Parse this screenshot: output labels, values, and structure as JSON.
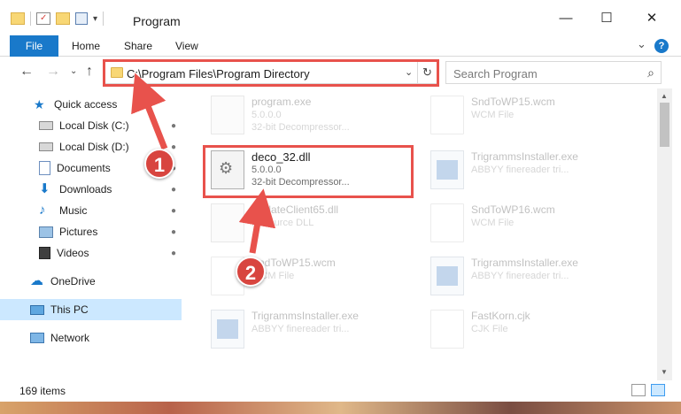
{
  "window": {
    "title": "Program",
    "min": "—",
    "max": "☐",
    "close": "✕"
  },
  "ribbon": {
    "file": "File",
    "home": "Home",
    "share": "Share",
    "view": "View",
    "expand": "⌄",
    "help": "?"
  },
  "nav": {
    "back": "←",
    "forward": "→",
    "recent": "⌄",
    "up": "↑",
    "address": "C:\\Program Files\\Program Directory",
    "address_dropdown": "⌄",
    "refresh": "↻",
    "search_placeholder": "Search Program",
    "search_icon": "⌕"
  },
  "sidebar": {
    "items": [
      {
        "label": "Quick access",
        "icon": "star-icon"
      },
      {
        "label": "Local Disk (C:)",
        "icon": "drive-icon"
      },
      {
        "label": "Local Disk (D:)",
        "icon": "drive-icon"
      },
      {
        "label": "Documents",
        "icon": "documents-icon"
      },
      {
        "label": "Downloads",
        "icon": "download-icon"
      },
      {
        "label": "Music",
        "icon": "music-icon"
      },
      {
        "label": "Pictures",
        "icon": "pictures-icon"
      },
      {
        "label": "Videos",
        "icon": "videos-icon"
      },
      {
        "label": "OneDrive",
        "icon": "cloud-icon"
      },
      {
        "label": "This PC",
        "icon": "computer-icon"
      },
      {
        "label": "Network",
        "icon": "network-icon"
      }
    ],
    "pin_glyph": "📌"
  },
  "files": [
    {
      "name": "program.exe",
      "line2": "5.0.0.0",
      "line3": "32-bit Decompressor...",
      "icon": "exe-icon"
    },
    {
      "name": "SndToWP15.wcm",
      "line2": "WCM File",
      "line3": "",
      "icon": "document-icon"
    },
    {
      "name": "deco_32.dll",
      "line2": "5.0.0.0",
      "line3": "32-bit Decompressor...",
      "icon": "dll-gear-icon"
    },
    {
      "name": "TrigrammsInstaller.exe",
      "line2": "ABBYY finereader tri...",
      "line3": "",
      "icon": "installer-icon"
    },
    {
      "name": "UpdateClient65.dll",
      "line2": "Resource DLL",
      "line3": "",
      "icon": "dll-gear-icon"
    },
    {
      "name": "SndToWP16.wcm",
      "line2": "WCM File",
      "line3": "",
      "icon": "document-icon"
    },
    {
      "name": "SndToWP15.wcm",
      "line2": "WCM File",
      "line3": "",
      "icon": "document-icon"
    },
    {
      "name": "TrigrammsInstaller.exe",
      "line2": "ABBYY finereader tri...",
      "line3": "",
      "icon": "installer-icon"
    },
    {
      "name": "TrigrammsInstaller.exe",
      "line2": "ABBYY finereader tri...",
      "line3": "",
      "icon": "installer-icon"
    },
    {
      "name": "FastKorn.cjk",
      "line2": "CJK File",
      "line3": "",
      "icon": "document-icon"
    }
  ],
  "status": {
    "count": "169 items"
  },
  "annotations": {
    "callout1": "1",
    "callout2": "2",
    "color": "#e8524c"
  },
  "colors": {
    "accent": "#1979ca",
    "selection": "#cce8ff"
  }
}
